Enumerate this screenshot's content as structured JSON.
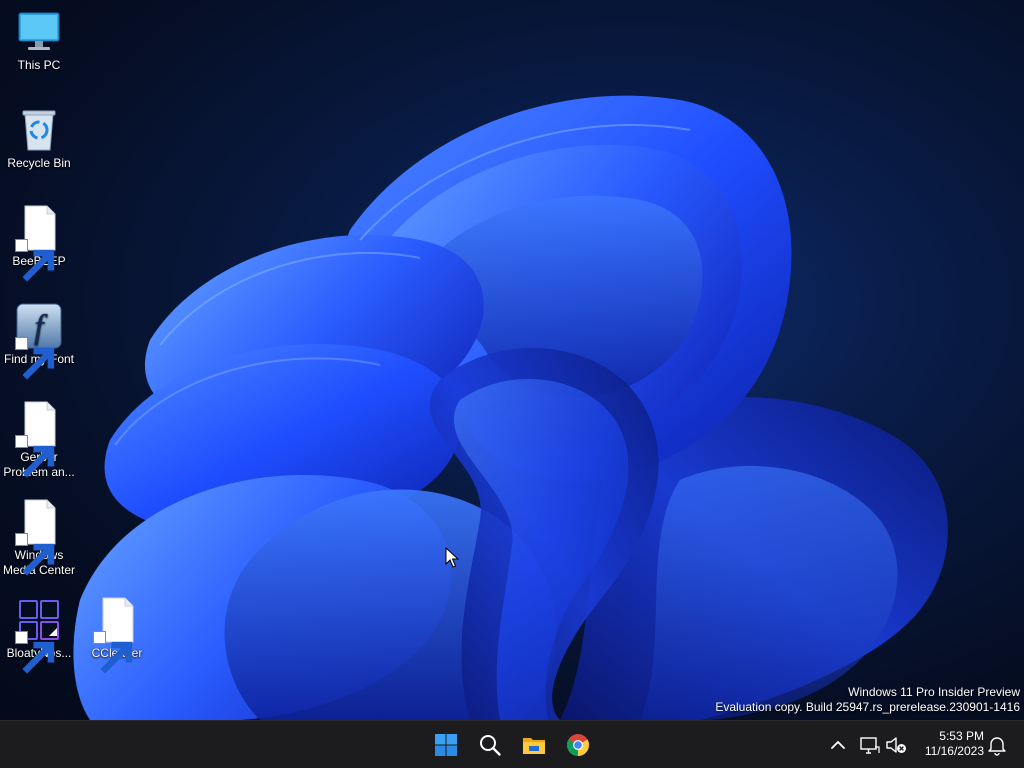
{
  "desktop": {
    "icons": [
      {
        "label": "This PC",
        "icon": "monitor-icon"
      },
      {
        "label": "Recycle Bin",
        "icon": "recycle-bin-icon"
      },
      {
        "label": "BeeBEEP",
        "icon": "blank-file-icon"
      },
      {
        "label": "Find my Font",
        "icon": "font-f-icon"
      },
      {
        "label": "Gerber Problem an...",
        "icon": "blank-file-icon"
      },
      {
        "label": "Windows Media Center",
        "icon": "blank-file-icon"
      },
      {
        "label": "BloatyNos...",
        "icon": "grid-squares-icon"
      },
      {
        "label": "CCleaner",
        "icon": "blank-file-icon"
      }
    ]
  },
  "watermark": {
    "line1": "Windows 11 Pro Insider Preview",
    "line2": "Evaluation copy. Build 25947.rs_prerelease.230901-1416"
  },
  "taskbar": {
    "apps": [
      {
        "name": "Start",
        "icon": "windows-logo-icon"
      },
      {
        "name": "Search",
        "icon": "search-icon"
      },
      {
        "name": "File Explorer",
        "icon": "folder-icon"
      },
      {
        "name": "Google Chrome",
        "icon": "chrome-icon"
      }
    ],
    "tray": {
      "time": "5:53 PM",
      "date": "11/16/2023"
    }
  },
  "colors": {
    "taskbar_bg": "#1c1c1e",
    "accent_blue": "#2b63ff",
    "start_blue": "#3aa0f3"
  }
}
